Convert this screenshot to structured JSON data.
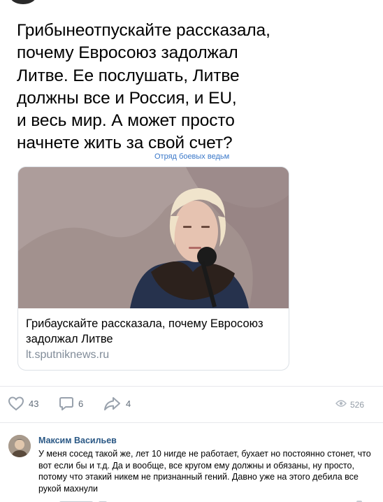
{
  "post": {
    "text": "Грибынеотпускайте рассказала,\nпочему Евросоюз задолжал\nЛитве. Ее послушать, Литве\nдолжны все и Россия, и EU,\nи весь мир. А может просто\nначнете жить за свой счет?",
    "watermark": "Отряд боевых ведьм"
  },
  "link_card": {
    "title": "Грибаускайте рассказала, почему Евросоюз задолжал Литве",
    "domain": "lt.sputniknews.ru"
  },
  "actions": {
    "likes": "43",
    "comments": "6",
    "shares": "4",
    "views": "526"
  },
  "icons": {
    "like": "heart-icon",
    "comment": "comment-bubble-icon",
    "share": "share-arrow-icon",
    "views": "eye-icon"
  },
  "colors": {
    "link": "#2a5885",
    "watermark": "#3a78c9",
    "muted": "#818c99",
    "action": "#626d7a"
  },
  "comment": {
    "author": "Максим Васильев",
    "text": "У меня сосед такой же, лет 10 нигде не работает, бухает но постоянно стонет, что вот если бы и т.д. Да и вообще, все кругом ему должны и обязаны, ну просто, потому что этакий никем не признанный гений. Давно уже на этого дебила все рукой махнули"
  }
}
